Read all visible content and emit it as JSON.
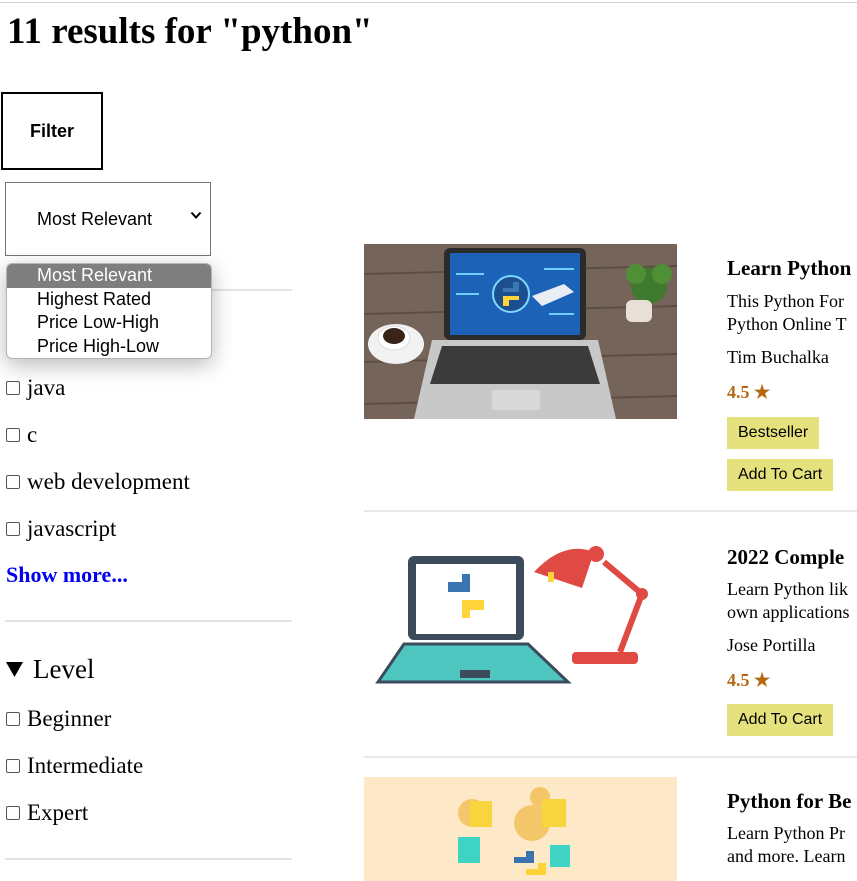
{
  "header": {
    "title": "11 results for \"python\""
  },
  "filter_button": {
    "label": "Filter"
  },
  "sort": {
    "selected": "Most Relevant",
    "options": [
      "Most Relevant",
      "Highest Rated",
      "Price Low-High",
      "Price High-Low"
    ]
  },
  "topics": {
    "items": [
      "java",
      "c",
      "web development",
      "javascript"
    ],
    "show_more": "Show more..."
  },
  "level": {
    "heading": "Level",
    "items": [
      "Beginner",
      "Intermediate",
      "Expert"
    ]
  },
  "courses": [
    {
      "title": "Learn Python",
      "desc_line1": "This Python For",
      "desc_line2": "Python Online T",
      "author": "Tim Buchalka",
      "rating": "4.5 ★",
      "badge": "Bestseller",
      "cart": "Add To Cart"
    },
    {
      "title": "2022 Comple",
      "desc_line1": "Learn Python lik",
      "desc_line2": "own applications",
      "author": "Jose Portilla",
      "rating": "4.5 ★",
      "cart": "Add To Cart"
    },
    {
      "title": "Python for Be",
      "desc_line1": "Learn Python Pr",
      "desc_line2": "and more. Learn"
    }
  ],
  "colors": {
    "link": "#0000ee",
    "rating": "#b4690e",
    "badge_bg": "#e5e27d",
    "selected_option_bg": "#7e7e7e"
  }
}
